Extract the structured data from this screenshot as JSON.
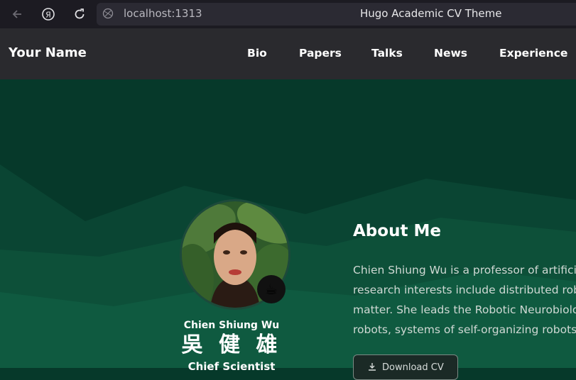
{
  "browser": {
    "url": "localhost:1313",
    "page_title": "Hugo Academic CV Theme",
    "icons": [
      "back-arrow-icon",
      "yandex-icon",
      "reload-icon",
      "site-info-icon"
    ]
  },
  "site": {
    "brand": "Your Name",
    "nav": [
      {
        "label": "Bio"
      },
      {
        "label": "Papers"
      },
      {
        "label": "Talks"
      },
      {
        "label": "News"
      },
      {
        "label": "Experience"
      }
    ]
  },
  "profile": {
    "name": "Chien Shiung Wu",
    "name_cjk": "吳 健 雄",
    "role": "Chief Scientist",
    "status_emoji": "☕"
  },
  "about": {
    "heading": "About Me",
    "lines": [
      "Chien Shiung Wu is a professor of artificia",
      "research interests include distributed robo",
      "matter. She leads the Robotic Neurobiolog",
      "robots, systems of self-organizing robots,"
    ],
    "cv_button": "Download CV"
  },
  "colors": {
    "hero_bg": "#06392a",
    "nav_bg": "#2a2a2e",
    "chrome_bg": "#1c1b22"
  }
}
